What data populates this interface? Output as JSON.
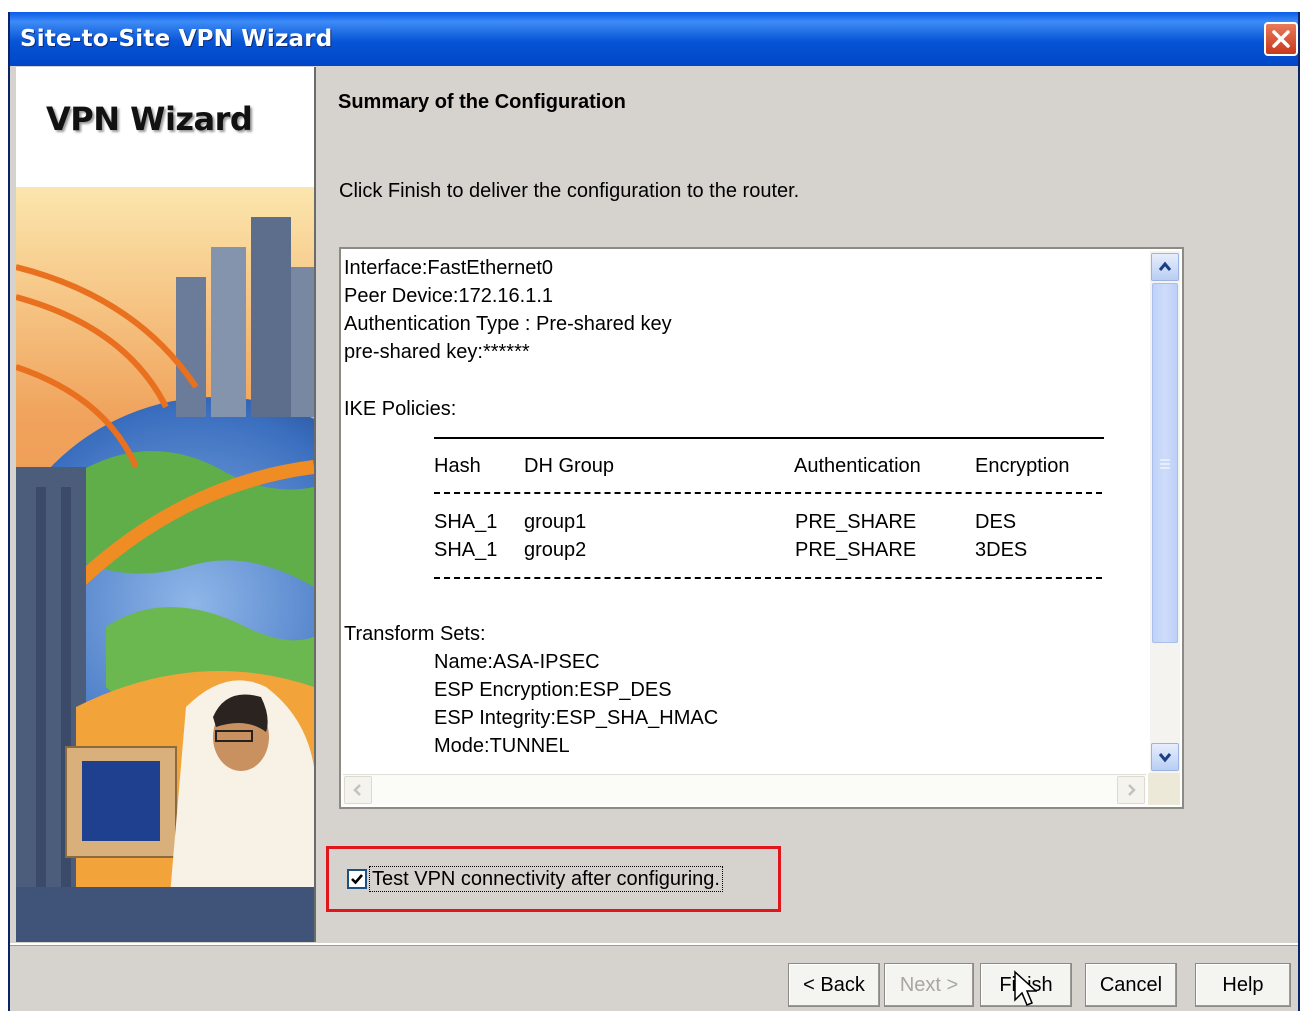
{
  "window": {
    "title": "Site-to-Site VPN Wizard"
  },
  "left_panel": {
    "heading": "VPN Wizard"
  },
  "content": {
    "title": "Summary of the Configuration",
    "instruction": "Click Finish to deliver the configuration to the router."
  },
  "summary": {
    "interface": "Interface:FastEthernet0",
    "peer_device": "Peer Device:172.16.1.1",
    "auth_type": "Authentication Type : Pre-shared key",
    "psk": "pre-shared key:******",
    "ike_heading": "IKE Policies:",
    "ike_columns": [
      "Hash",
      "DH Group",
      "Authentication",
      "Encryption"
    ],
    "ike_rows": [
      [
        "SHA_1",
        "group1",
        "PRE_SHARE",
        "DES"
      ],
      [
        "SHA_1",
        "group2",
        "PRE_SHARE",
        "3DES"
      ]
    ],
    "transform_heading": "Transform Sets:",
    "transform_name": "Name:ASA-IPSEC",
    "transform_encryption": "ESP Encryption:ESP_DES",
    "transform_integrity": "ESP Integrity:ESP_SHA_HMAC",
    "transform_mode": "Mode:TUNNEL"
  },
  "test_vpn": {
    "label": "Test VPN connectivity after configuring.",
    "checked": true
  },
  "buttons": {
    "back": "< Back",
    "next": "Next >",
    "finish": "Finish",
    "cancel": "Cancel",
    "help": "Help"
  },
  "colors": {
    "titlebar": "#0754d6",
    "highlight": "#e0161c",
    "dialog_bg": "#d6d3ce"
  }
}
